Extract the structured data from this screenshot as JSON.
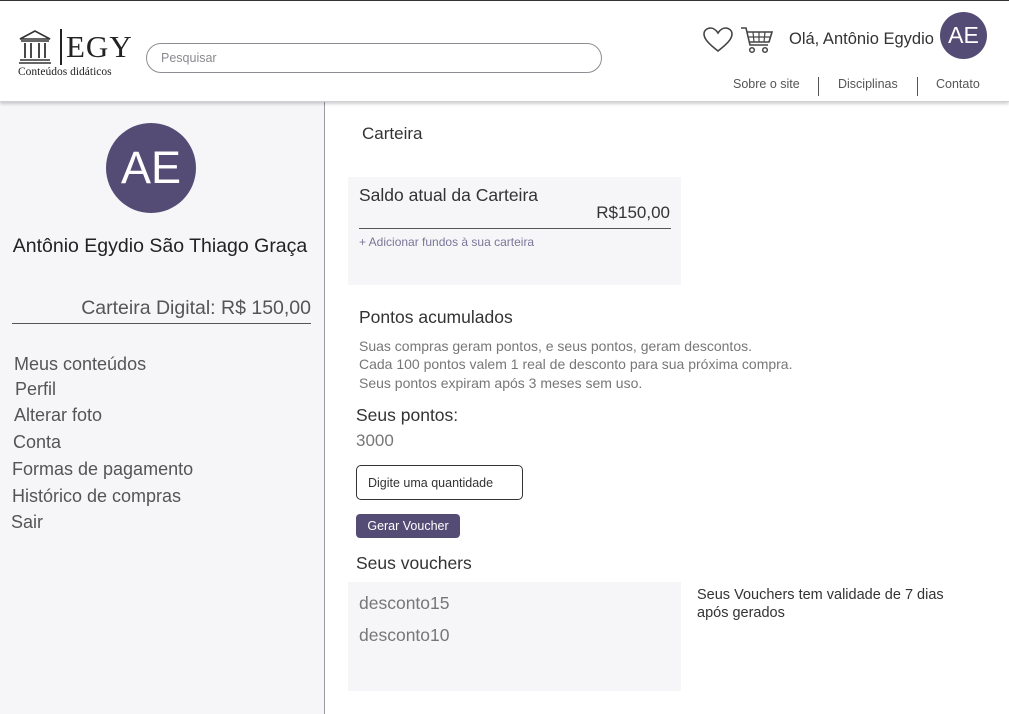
{
  "header": {
    "logo_text": "EGY",
    "logo_subtitle": "Conteúdos didáticos",
    "search_placeholder": "Pesquisar",
    "greeting": "Olá, Antônio Egydio",
    "avatar_initials": "AE",
    "nav": [
      "Sobre o site",
      "Disciplinas",
      "Contato"
    ],
    "accent_color": "#554c75"
  },
  "sidebar": {
    "avatar_initials": "AE",
    "user_name": "Antônio Egydio São Thiago Graça",
    "wallet_label": "Carteira Digital: R$ 150,00",
    "menu": [
      "Meus conteúdos",
      "Perfil",
      "Alterar foto",
      "Conta",
      "Formas de pagamento",
      "Histórico de compras",
      "Sair"
    ]
  },
  "main": {
    "title": "Carteira",
    "balance": {
      "label": "Saldo atual da Carteira",
      "value": "R$150,00",
      "add_funds": "+ Adicionar fundos à sua carteira"
    },
    "points": {
      "title": "Pontos acumulados",
      "description": [
        "Suas compras geram pontos, e seus pontos, geram descontos.",
        "Cada 100 pontos valem 1 real de desconto para sua próxima compra.",
        "Seus pontos expiram após 3 meses sem uso."
      ],
      "your_points_label": "Seus pontos:",
      "your_points_value": "3000",
      "quantity_placeholder": "Digite uma quantidade",
      "generate_button": "Gerar Voucher"
    },
    "vouchers": {
      "title": "Seus vouchers",
      "items": [
        "desconto15",
        "desconto10"
      ],
      "note": "Seus Vouchers tem validade de 7 dias após gerados"
    }
  }
}
